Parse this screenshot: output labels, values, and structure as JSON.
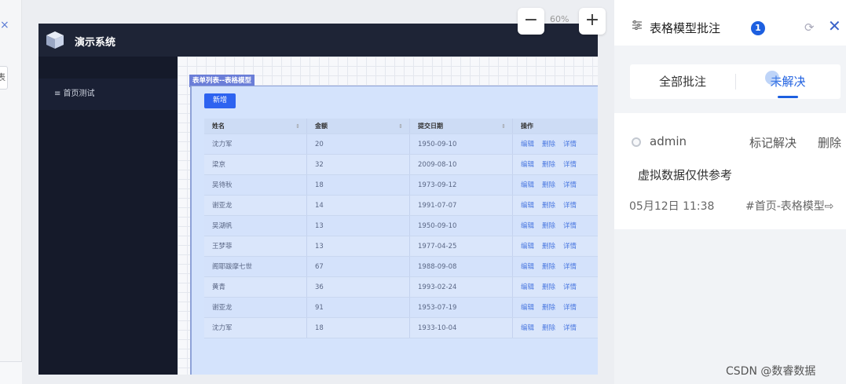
{
  "preview": {
    "app_title": "演示系统",
    "sidebar_item": "≡ 首页测试",
    "component_label": "表单列表--表格模型",
    "add_button": "新增",
    "columns": [
      "姓名",
      "金额",
      "提交日期",
      "操作"
    ],
    "sort_glyph": "⇕",
    "actions": [
      "编辑",
      "删除",
      "详情"
    ],
    "rows": [
      [
        "沈力军",
        "20",
        "1950-09-10"
      ],
      [
        "梁京",
        "32",
        "2009-08-10"
      ],
      [
        "吴待秋",
        "18",
        "1973-09-12"
      ],
      [
        "谢亚龙",
        "14",
        "1991-07-07"
      ],
      [
        "吴湖帆",
        "13",
        "1950-09-10"
      ],
      [
        "王梦菲",
        "13",
        "1977-04-25"
      ],
      [
        "阁耶跋摩七世",
        "67",
        "1988-09-08"
      ],
      [
        "黄青",
        "36",
        "1993-02-24"
      ],
      [
        "谢亚龙",
        "91",
        "1953-07-19"
      ],
      [
        "沈力军",
        "18",
        "1933-10-04"
      ]
    ]
  },
  "zoom": {
    "minus": "−",
    "level": "60%",
    "plus": "+"
  },
  "left_strip": {
    "close": "×",
    "tab": "表"
  },
  "panel": {
    "title": "表格模型批注",
    "badge_count": "1",
    "refresh": "⟳",
    "close": "✕",
    "tabs": {
      "all": "全部批注",
      "unresolved": "未解决"
    },
    "annotation": {
      "user": "admin",
      "mark_resolved": "标记解决",
      "delete": "删除",
      "comment": "虚拟数据仅供参考",
      "time": "05月12日 11:38",
      "link": "#首页-表格模型⇨"
    }
  },
  "watermark": "CSDN @数睿数据",
  "colors": {
    "accent": "#1d5fe0",
    "preview_dark": "#15192a",
    "table_bg": "#d4e3fc"
  }
}
